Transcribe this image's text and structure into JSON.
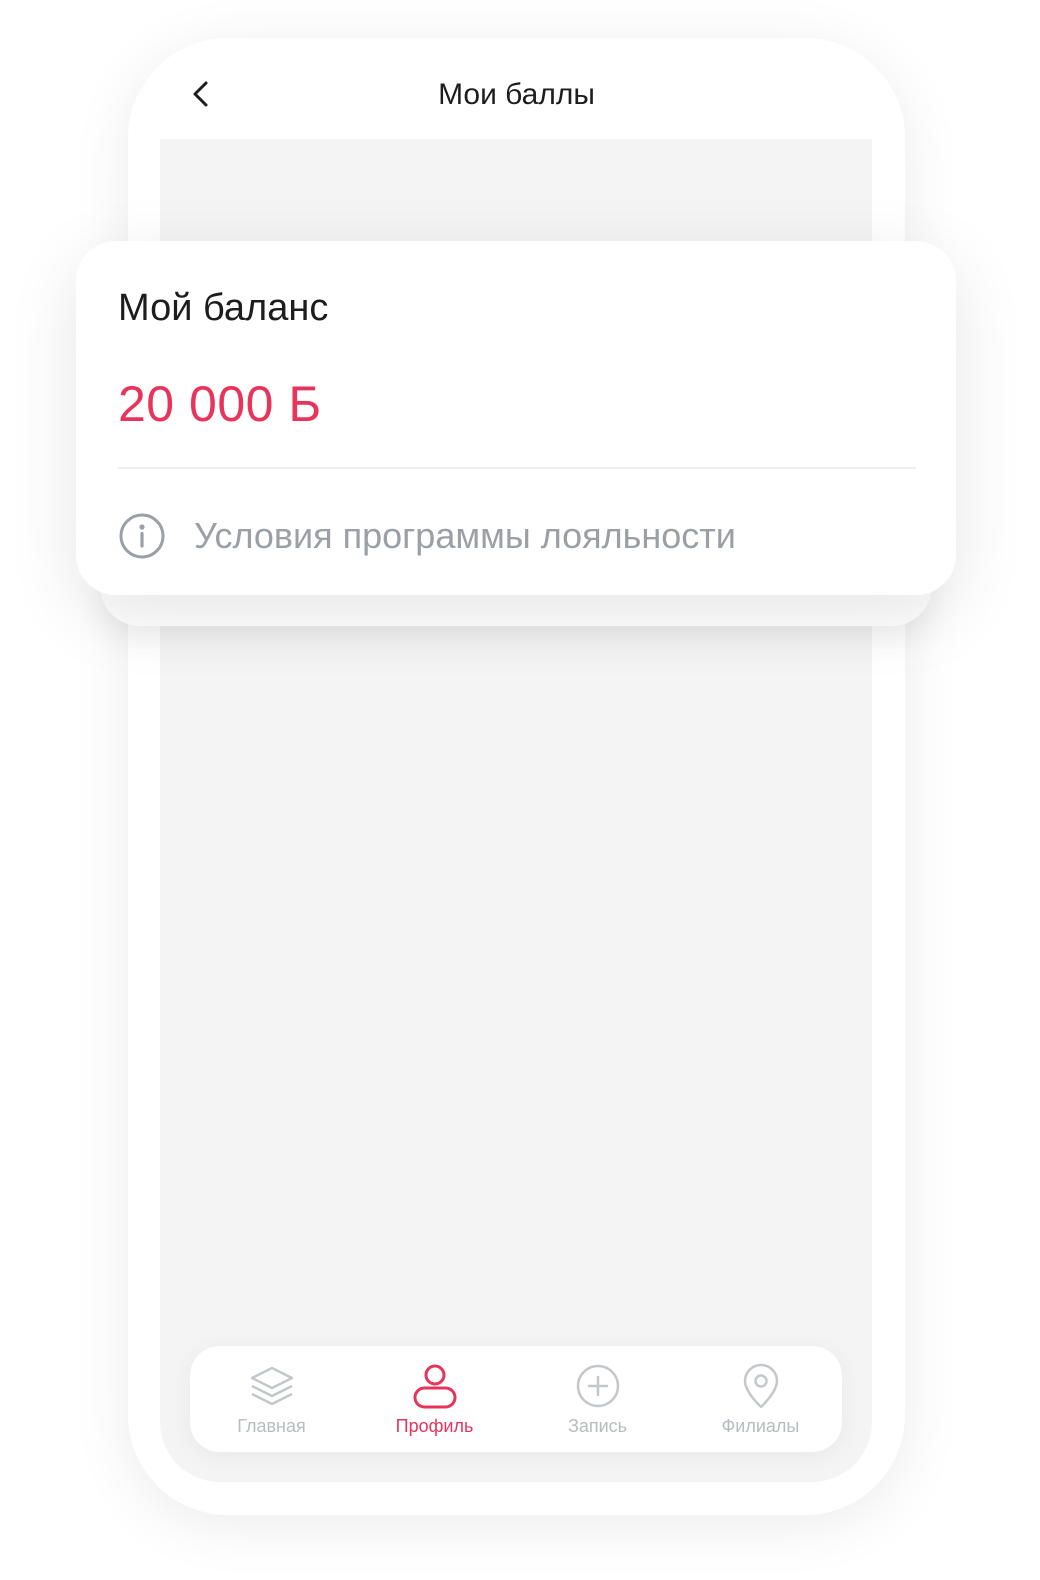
{
  "header": {
    "title": "Мои баллы",
    "back_icon": "chevron-left-icon"
  },
  "balance_card": {
    "title": "Мой баланс",
    "balance": "20 000 Б",
    "loyalty_link": "Условия программы лояльности",
    "info_icon": "info-circle-icon"
  },
  "tabbar": {
    "tabs": [
      {
        "label": "Главная",
        "icon": "layers-icon",
        "active": false
      },
      {
        "label": "Профиль",
        "icon": "user-icon",
        "active": true
      },
      {
        "label": "Запись",
        "icon": "plus-circle-icon",
        "active": false
      },
      {
        "label": "Филиалы",
        "icon": "map-pin-icon",
        "active": false
      }
    ]
  },
  "colors": {
    "accent": "#e8335a",
    "muted": "#9aa0a6",
    "inactive_tab": "#b8bcc2",
    "text": "#1d1d1f",
    "screen_bg": "#f4f4f4"
  }
}
